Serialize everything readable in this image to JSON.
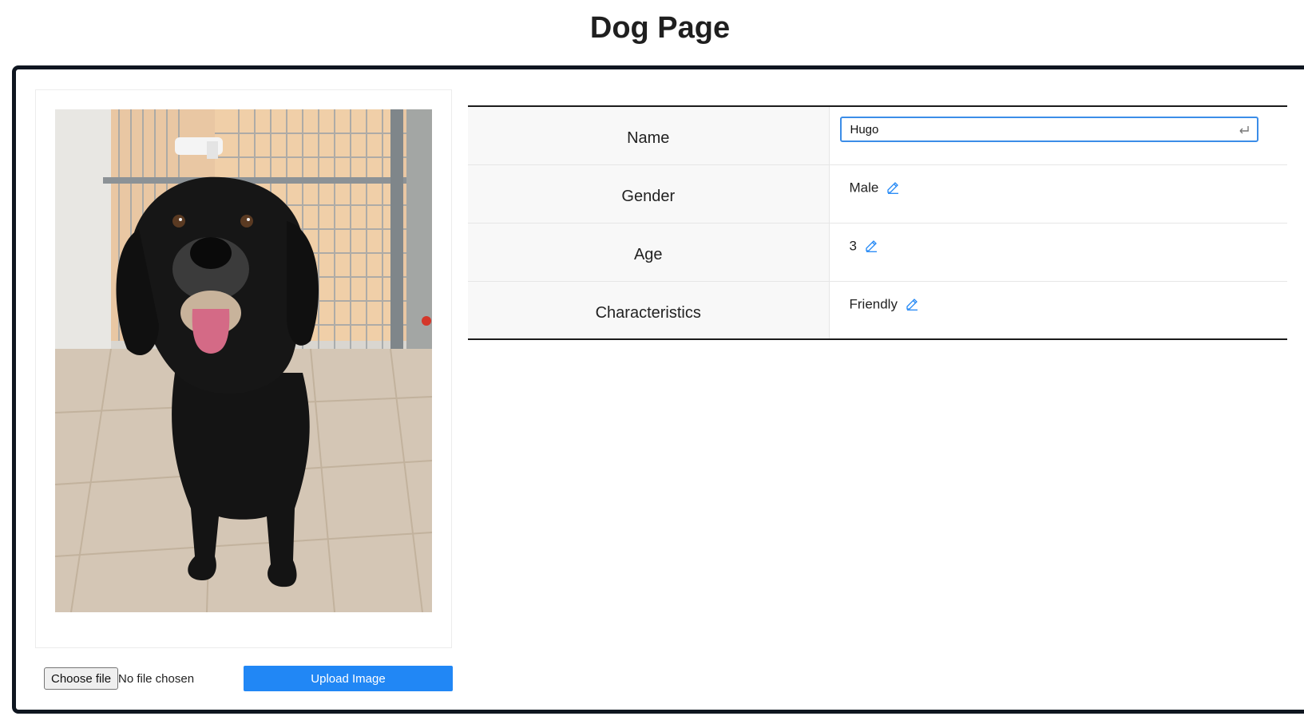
{
  "page": {
    "title": "Dog Page"
  },
  "photo": {
    "alt": "Photo of a black dog standing in a kennel"
  },
  "upload": {
    "choose_file_label": "Choose file",
    "no_file_text": "No file chosen",
    "upload_button_label": "Upload Image"
  },
  "details": {
    "rows": [
      {
        "label": "Name",
        "value": "Hugo",
        "editing": true
      },
      {
        "label": "Gender",
        "value": "Male",
        "editing": false
      },
      {
        "label": "Age",
        "value": "3",
        "editing": false
      },
      {
        "label": "Characteristics",
        "value": "Friendly",
        "editing": false
      }
    ]
  },
  "icons": {
    "edit": "edit-icon",
    "enter": "enter-icon"
  },
  "colors": {
    "accent": "#2187f5",
    "input_focus_border": "#3b8de8",
    "frame_border": "#0f1620"
  }
}
